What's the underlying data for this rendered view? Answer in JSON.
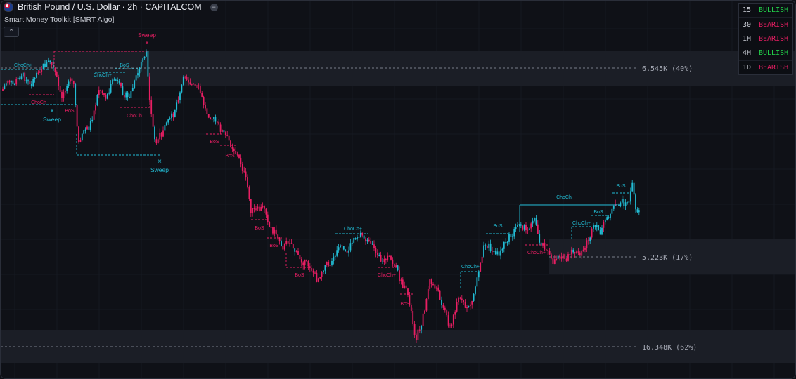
{
  "header": {
    "title": "British Pound / U.S. Dollar · 2h · CAPITALCOM",
    "indicator_name": "Smart Money Toolkit [SMRT Algo]",
    "collapse_icon": "minus-icon",
    "chevron_icon": "chevron-up-icon"
  },
  "colors": {
    "background": "#0f1117",
    "bull": "#22bcd4",
    "bear": "#e91e63",
    "bullish_text": "#22d34a",
    "bearish_text": "#e91e63",
    "zone": "#1b1e26"
  },
  "mtf_table": [
    {
      "tf": "15",
      "bias": "BULLISH"
    },
    {
      "tf": "30",
      "bias": "BEARISH"
    },
    {
      "tf": "1H",
      "bias": "BEARISH"
    },
    {
      "tf": "4H",
      "bias": "BULLISH"
    },
    {
      "tf": "1D",
      "bias": "BEARISH"
    }
  ],
  "zone_labels": {
    "top": "6.545K (40%)",
    "middle": "5.223K (17%)",
    "bottom": "16.348K (62%)"
  },
  "structure_labels": {
    "sweep": "Sweep",
    "bos": "BoS",
    "choch": "ChoCh",
    "choch_plus": "ChoCh+"
  }
}
